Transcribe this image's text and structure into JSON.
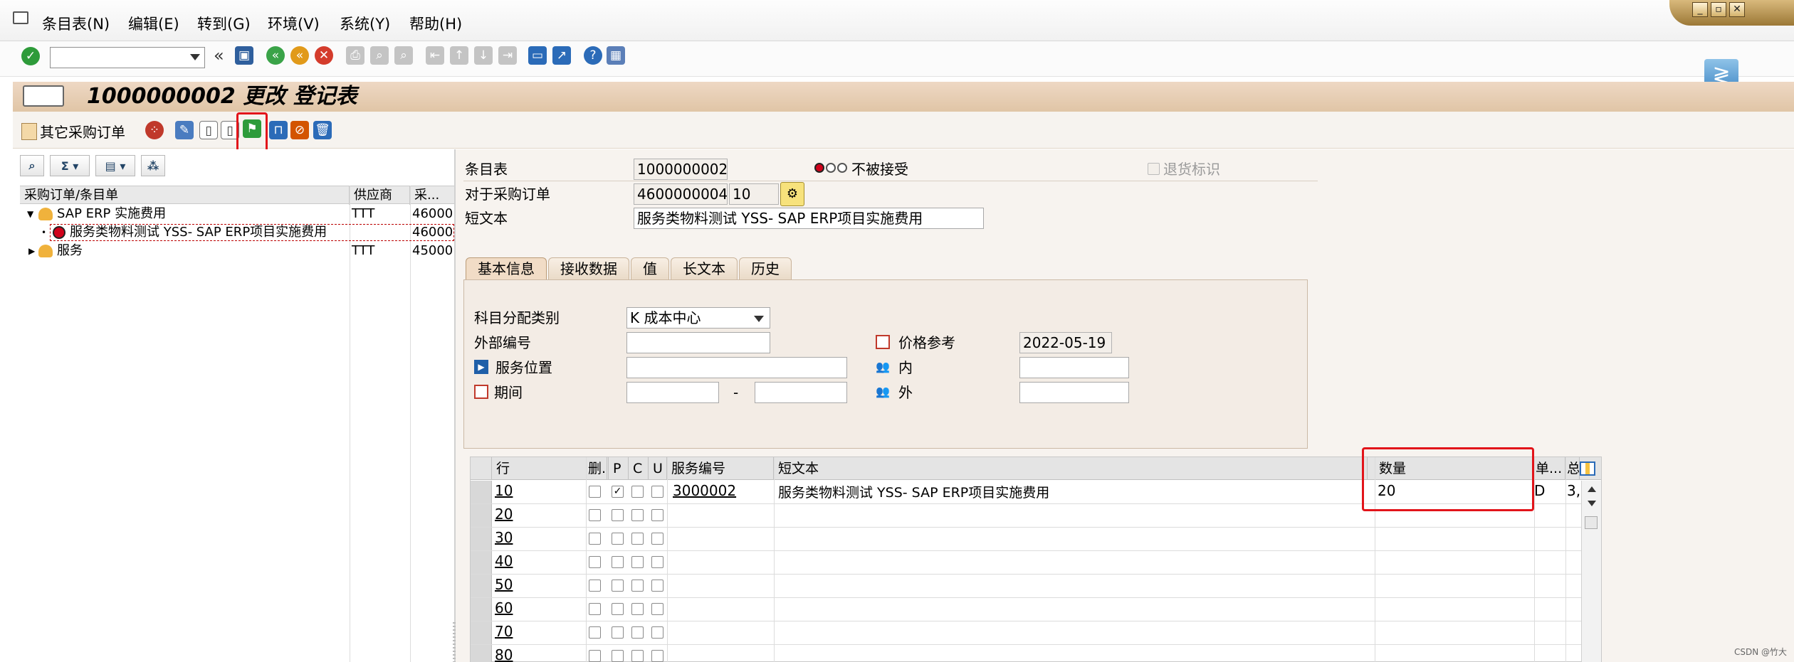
{
  "menu": {
    "items": [
      "条目表(N)",
      "编辑(E)",
      "转到(G)",
      "环境(V)",
      "系统(Y)",
      "帮助(H)"
    ]
  },
  "toolbar": {
    "command_value": "",
    "back_label": "«"
  },
  "title": {
    "text": "1000000002 更改 登记表"
  },
  "app_toolbar": {
    "other_po_label": "其它采购订单"
  },
  "tree": {
    "headers": [
      "采购订单/条目单",
      "供应商",
      "采..."
    ],
    "rows": [
      {
        "label": "SAP ERP 实施费用",
        "vendor": "TTT",
        "po": "46000"
      },
      {
        "label": "服务类物料测试 YSS- SAP ERP项目实施费用",
        "vendor": "",
        "po": "46000"
      },
      {
        "label": "服务",
        "vendor": "TTT",
        "po": "45000"
      }
    ]
  },
  "header": {
    "entry_sheet_label": "条目表",
    "entry_sheet_value": "1000000002",
    "status_label": "不被接受",
    "return_flag_label": "退货标识",
    "po_label": "对于采购订单",
    "po_value": "4600000004",
    "po_item": "10",
    "short_text_label": "短文本",
    "short_text_value": "服务类物料测试 YSS- SAP ERP项目实施费用"
  },
  "tabs": [
    "基本信息",
    "接收数据",
    "值",
    "长文本",
    "历史"
  ],
  "basic": {
    "acct_assign_label": "科目分配类别",
    "acct_assign_value": "K 成本中心",
    "ext_no_label": "外部编号",
    "ext_no_value": "",
    "location_label": "服务位置",
    "location_value": "",
    "period_label": "期间",
    "period_from": "",
    "period_sep": "-",
    "period_to": "",
    "price_ref_label": "价格参考",
    "price_ref_value": "2022-05-19",
    "inner_label": "内",
    "inner_value": "",
    "outer_label": "外",
    "outer_value": ""
  },
  "grid": {
    "headers": {
      "line": "行",
      "del": "删.",
      "p": "P",
      "c": "C",
      "u": "U",
      "service_no": "服务编号",
      "short_text": "短文本",
      "qty": "数量",
      "unit": "单...",
      "total": "总"
    },
    "rows": [
      {
        "line": "10",
        "p_checked": true,
        "service_no": "3000002",
        "short_text": "服务类物料测试 YSS- SAP ERP项目实施费用",
        "qty": "20",
        "unit": "D",
        "total": "3,"
      },
      {
        "line": "20",
        "p_checked": false,
        "service_no": "",
        "short_text": "",
        "qty": "",
        "unit": "",
        "total": ""
      },
      {
        "line": "30",
        "p_checked": false,
        "service_no": "",
        "short_text": "",
        "qty": "",
        "unit": "",
        "total": ""
      },
      {
        "line": "40",
        "p_checked": false,
        "service_no": "",
        "short_text": "",
        "qty": "",
        "unit": "",
        "total": ""
      },
      {
        "line": "50",
        "p_checked": false,
        "service_no": "",
        "short_text": "",
        "qty": "",
        "unit": "",
        "total": ""
      },
      {
        "line": "60",
        "p_checked": false,
        "service_no": "",
        "short_text": "",
        "qty": "",
        "unit": "",
        "total": ""
      },
      {
        "line": "70",
        "p_checked": false,
        "service_no": "",
        "short_text": "",
        "qty": "",
        "unit": "",
        "total": ""
      },
      {
        "line": "80",
        "p_checked": false,
        "service_no": "",
        "short_text": "",
        "qty": "",
        "unit": "",
        "total": ""
      }
    ]
  },
  "watermark": "CSDN @竹大",
  "colors": {
    "title_band": "#e0c5a6",
    "highlight_box": "#e2141a",
    "status_red": "#d0021b"
  }
}
